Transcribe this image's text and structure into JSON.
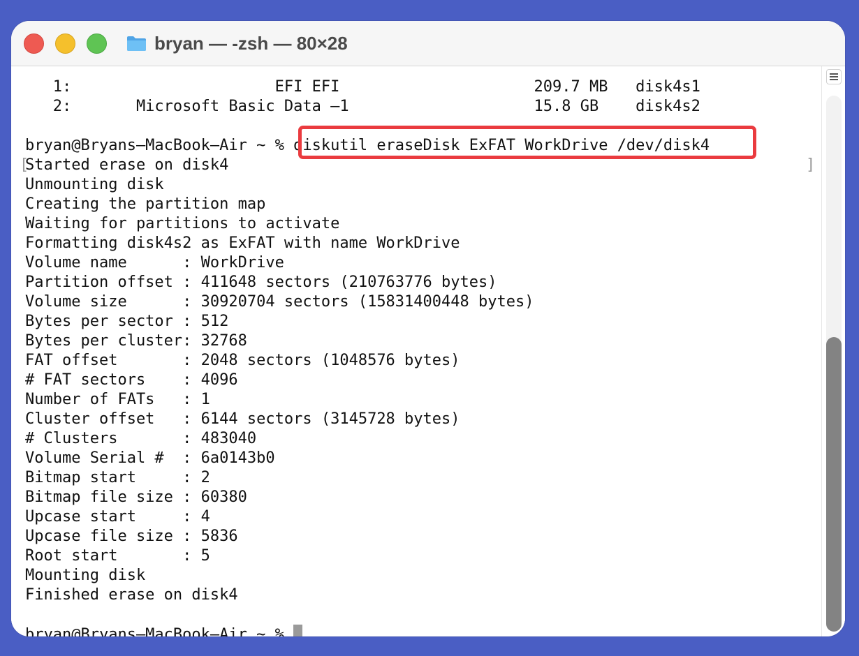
{
  "window": {
    "title": "bryan — -zsh — 80×28",
    "colors": {
      "background": "#4a5ec4",
      "highlight": "#ea3b3f",
      "close": "#ee5a52",
      "minimize": "#f5c02c",
      "maximize": "#5fc454"
    }
  },
  "icons": {
    "folder": "folder-icon",
    "scroll_menu": "menu-icon"
  },
  "terminal": {
    "lines": [
      "   1:                      EFI EFI                     209.7 MB   disk4s1",
      "   2:       Microsoft Basic Data –1                    15.8 GB    disk4s2",
      "",
      "bryan@Bryans–MacBook–Air ~ % diskutil eraseDisk ExFAT WorkDrive /dev/disk4",
      "Started erase on disk4",
      "Unmounting disk",
      "Creating the partition map",
      "Waiting for partitions to activate",
      "Formatting disk4s2 as ExFAT with name WorkDrive",
      "Volume name      : WorkDrive",
      "Partition offset : 411648 sectors (210763776 bytes)",
      "Volume size      : 30920704 sectors (15831400448 bytes)",
      "Bytes per sector : 512",
      "Bytes per cluster: 32768",
      "FAT offset       : 2048 sectors (1048576 bytes)",
      "# FAT sectors    : 4096",
      "Number of FATs   : 1",
      "Cluster offset   : 6144 sectors (3145728 bytes)",
      "# Clusters       : 483040",
      "Volume Serial #  : 6a0143b0",
      "Bitmap start     : 2",
      "Bitmap file size : 60380",
      "Upcase start     : 4",
      "Upcase file size : 5836",
      "Root start       : 5",
      "Mounting disk",
      "Finished erase on disk4"
    ],
    "prompt": "bryan@Bryans–MacBook–Air ~ % ",
    "mark_open": "[",
    "mark_close": "]"
  },
  "scrollbar": {
    "position": 0.45,
    "visible_fraction": 0.55
  }
}
